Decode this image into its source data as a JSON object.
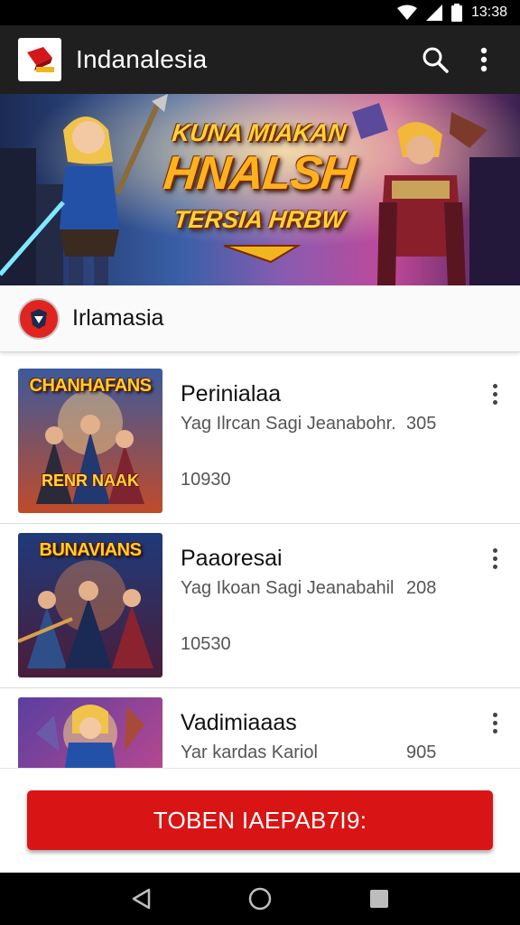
{
  "status_bar": {
    "time": "13:38",
    "icons": [
      "wifi-icon",
      "signal-icon",
      "battery-icon"
    ]
  },
  "app_bar": {
    "title": "Indanalesia",
    "icons": [
      "search-icon",
      "more-vert-icon"
    ]
  },
  "banner": {
    "line1": "KUNA MIAKAN",
    "line2": "HNALSH",
    "line3": "TERSIA HRBW"
  },
  "section": {
    "title": "Irlamasia"
  },
  "items": [
    {
      "thumb_top": "CHANHAFANS",
      "thumb_bottom": "RENR NAAK",
      "title": "Perinialaa",
      "subtitle": "Yag Ilrcan Sagi Jeanabohr.",
      "subtitle_num": "305",
      "count": "10930"
    },
    {
      "thumb_top": "BUNAVIANS",
      "thumb_bottom": "",
      "title": "Paaoresai",
      "subtitle": "Yag Ikoan Sagi Jeanabahil",
      "subtitle_num": "208",
      "count": "10530"
    },
    {
      "thumb_top": "",
      "thumb_bottom": "",
      "title": "Vadimiaaas",
      "subtitle": "Yar kardas Kariol",
      "subtitle_num": "905",
      "count": ""
    }
  ],
  "cta": {
    "label": "TOBEN IAEPAB7I9:"
  },
  "nav_bar": {
    "icons": [
      "back-icon",
      "home-icon",
      "recents-icon"
    ]
  },
  "colors": {
    "accent": "#d91414",
    "app_bar": "#1f1f1f",
    "status_bar": "#000000"
  }
}
